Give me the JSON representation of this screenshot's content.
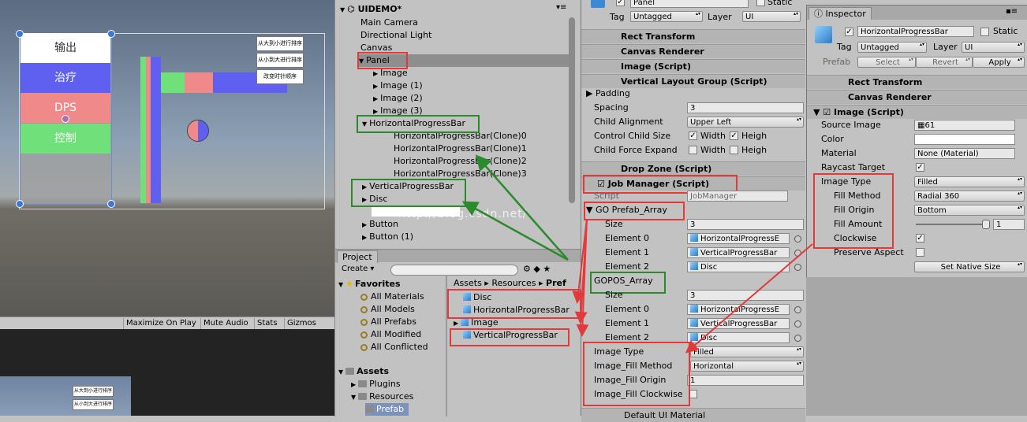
{
  "scene": {
    "health_buttons": [
      "输出",
      "治疗",
      "DPS",
      "控制"
    ],
    "sort_buttons": [
      "从大到小进行排序",
      "从小到大进行排序",
      "改变时针顺序"
    ],
    "toolbar": [
      "Maximize On Play",
      "Mute Audio",
      "Stats",
      "Gizmos"
    ],
    "game_sort_buttons": [
      "从大到小进行排序",
      "从小到大进行排序"
    ],
    "colors": {
      "output": "#ffffff",
      "heal": "#5f5ff0",
      "dps": "#f08a8a",
      "control": "#6fe07a"
    }
  },
  "hierarchy": {
    "title": "UIDEMO*",
    "items": [
      {
        "label": "Main Camera",
        "indent": 0
      },
      {
        "label": "Directional Light",
        "indent": 0
      },
      {
        "label": "Canvas",
        "indent": 0
      },
      {
        "label": "Panel",
        "indent": 1,
        "tri": "▼"
      },
      {
        "label": "Image",
        "indent": 2,
        "tri": "▶"
      },
      {
        "label": "Image (1)",
        "indent": 2,
        "tri": "▶"
      },
      {
        "label": "Image (2)",
        "indent": 2,
        "tri": "▶"
      },
      {
        "label": "Image (3)",
        "indent": 2,
        "tri": "▶"
      },
      {
        "label": "HorizontalProgressBar",
        "indent": 1,
        "tri": "▼"
      },
      {
        "label": "HorizontalProgressBar(Clone)0",
        "indent": 3
      },
      {
        "label": "HorizontalProgressBar(Clone)1",
        "indent": 3
      },
      {
        "label": "HorizontalProgressBar(Clone)2",
        "indent": 3
      },
      {
        "label": "HorizontalProgressBar(Clone)3",
        "indent": 3
      },
      {
        "label": "VerticalProgressBar",
        "indent": 1,
        "tri": "▶"
      },
      {
        "label": "Disc",
        "indent": 1,
        "tri": "▶"
      },
      {
        "label": "",
        "indent": 1
      },
      {
        "label": "Button",
        "indent": 1,
        "tri": "▶"
      },
      {
        "label": "Button (1)",
        "indent": 1,
        "tri": "▶"
      }
    ]
  },
  "project": {
    "tab": "Project",
    "create": "Create",
    "favorites_title": "Favorites",
    "favorites": [
      "All Materials",
      "All Models",
      "All Prefabs",
      "All Modified",
      "All Conflicted"
    ],
    "assets_title": "Assets",
    "assets_tree": [
      "Plugins",
      "Resources",
      "Prefab"
    ],
    "breadcrumb": [
      "Assets",
      "Resources",
      "Pref"
    ],
    "files": [
      "Disc",
      "HorizontalProgressBar",
      "Image",
      "VerticalProgressBar"
    ]
  },
  "inspector_mid": {
    "panel_name": "Panel",
    "static_label": "Static",
    "tag_label": "Tag",
    "tag_value": "Untagged",
    "layer_label": "Layer",
    "layer_value": "UI",
    "components": [
      "Rect Transform",
      "Canvas Renderer",
      "Image (Script)",
      "Vertical Layout Group (Script)",
      "Drop Zone (Script)",
      "Job Manager (Script)"
    ],
    "padding": "Padding",
    "spacing_label": "Spacing",
    "spacing_value": "3",
    "child_alignment_label": "Child Alignment",
    "child_alignment_value": "Upper Left",
    "control_child_size": "Control Child Size",
    "child_force_expand": "Child Force Expand",
    "width": "Width",
    "height": "Heigh",
    "script_label": "Script",
    "script_value": "JobManager",
    "go_prefab_array": "GO Prefab_Array",
    "size_label": "Size",
    "go_size": "3",
    "element_labels": [
      "Element 0",
      "Element 1",
      "Element 2"
    ],
    "go_elements": [
      "HorizontalProgressE",
      "VerticalProgressBar",
      "Disc"
    ],
    "gopos_array": "GOPOS_Array",
    "gopos_size": "3",
    "gopos_elements": [
      "HorizontalProgressE",
      "VerticalProgressBar",
      "Disc"
    ],
    "image_type_label": "Image Type",
    "image_type_value": "Filled",
    "fill_method_label": "Image_Fill Method",
    "fill_method_value": "Horizontal",
    "fill_origin_label": "Image_Fill Origin",
    "fill_origin_value": "1",
    "fill_clockwise_label": "Image_Fill Clockwise",
    "bottom_component": "Default UI Material"
  },
  "inspector_right": {
    "tab": "Inspector",
    "object_name": "HorizontalProgressBar",
    "static_label": "Static",
    "tag_label": "Tag",
    "tag_value": "Untagged",
    "layer_label": "Layer",
    "layer_value": "UI",
    "prefab_label": "Prefab",
    "select": "Select",
    "revert": "Revert",
    "apply": "Apply",
    "components": [
      "Rect Transform",
      "Canvas Renderer",
      "Image (Script)"
    ],
    "source_image_label": "Source Image",
    "source_image_value": "61",
    "color_label": "Color",
    "material_label": "Material",
    "material_value": "None (Material)",
    "raycast_label": "Raycast Target",
    "image_type_label": "Image Type",
    "image_type_value": "Filled",
    "fill_method_label": "Fill Method",
    "fill_method_value": "Radial 360",
    "fill_origin_label": "Fill Origin",
    "fill_origin_value": "Bottom",
    "fill_amount_label": "Fill Amount",
    "fill_amount_value": "1",
    "fill_amount": 1,
    "clockwise_label": "Clockwise",
    "preserve_label": "Preserve Aspect",
    "set_native": "Set Native Size"
  },
  "watermark": "http://blog.csdn.net/"
}
